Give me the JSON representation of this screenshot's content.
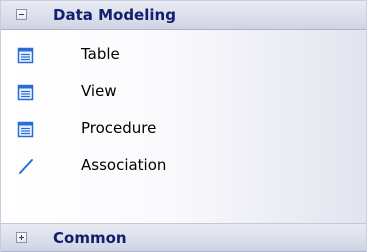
{
  "toolbox": {
    "groups": [
      {
        "title": "Data Modeling",
        "expanded": true,
        "items": [
          {
            "label": "Table",
            "icon": "table-icon"
          },
          {
            "label": "View",
            "icon": "view-icon"
          },
          {
            "label": "Procedure",
            "icon": "procedure-icon"
          },
          {
            "label": "Association",
            "icon": "association-line-icon"
          }
        ]
      },
      {
        "title": "Common",
        "expanded": false,
        "items": []
      }
    ]
  },
  "colors": {
    "header_text": "#10206e",
    "icon_blue": "#2b6bd6"
  }
}
